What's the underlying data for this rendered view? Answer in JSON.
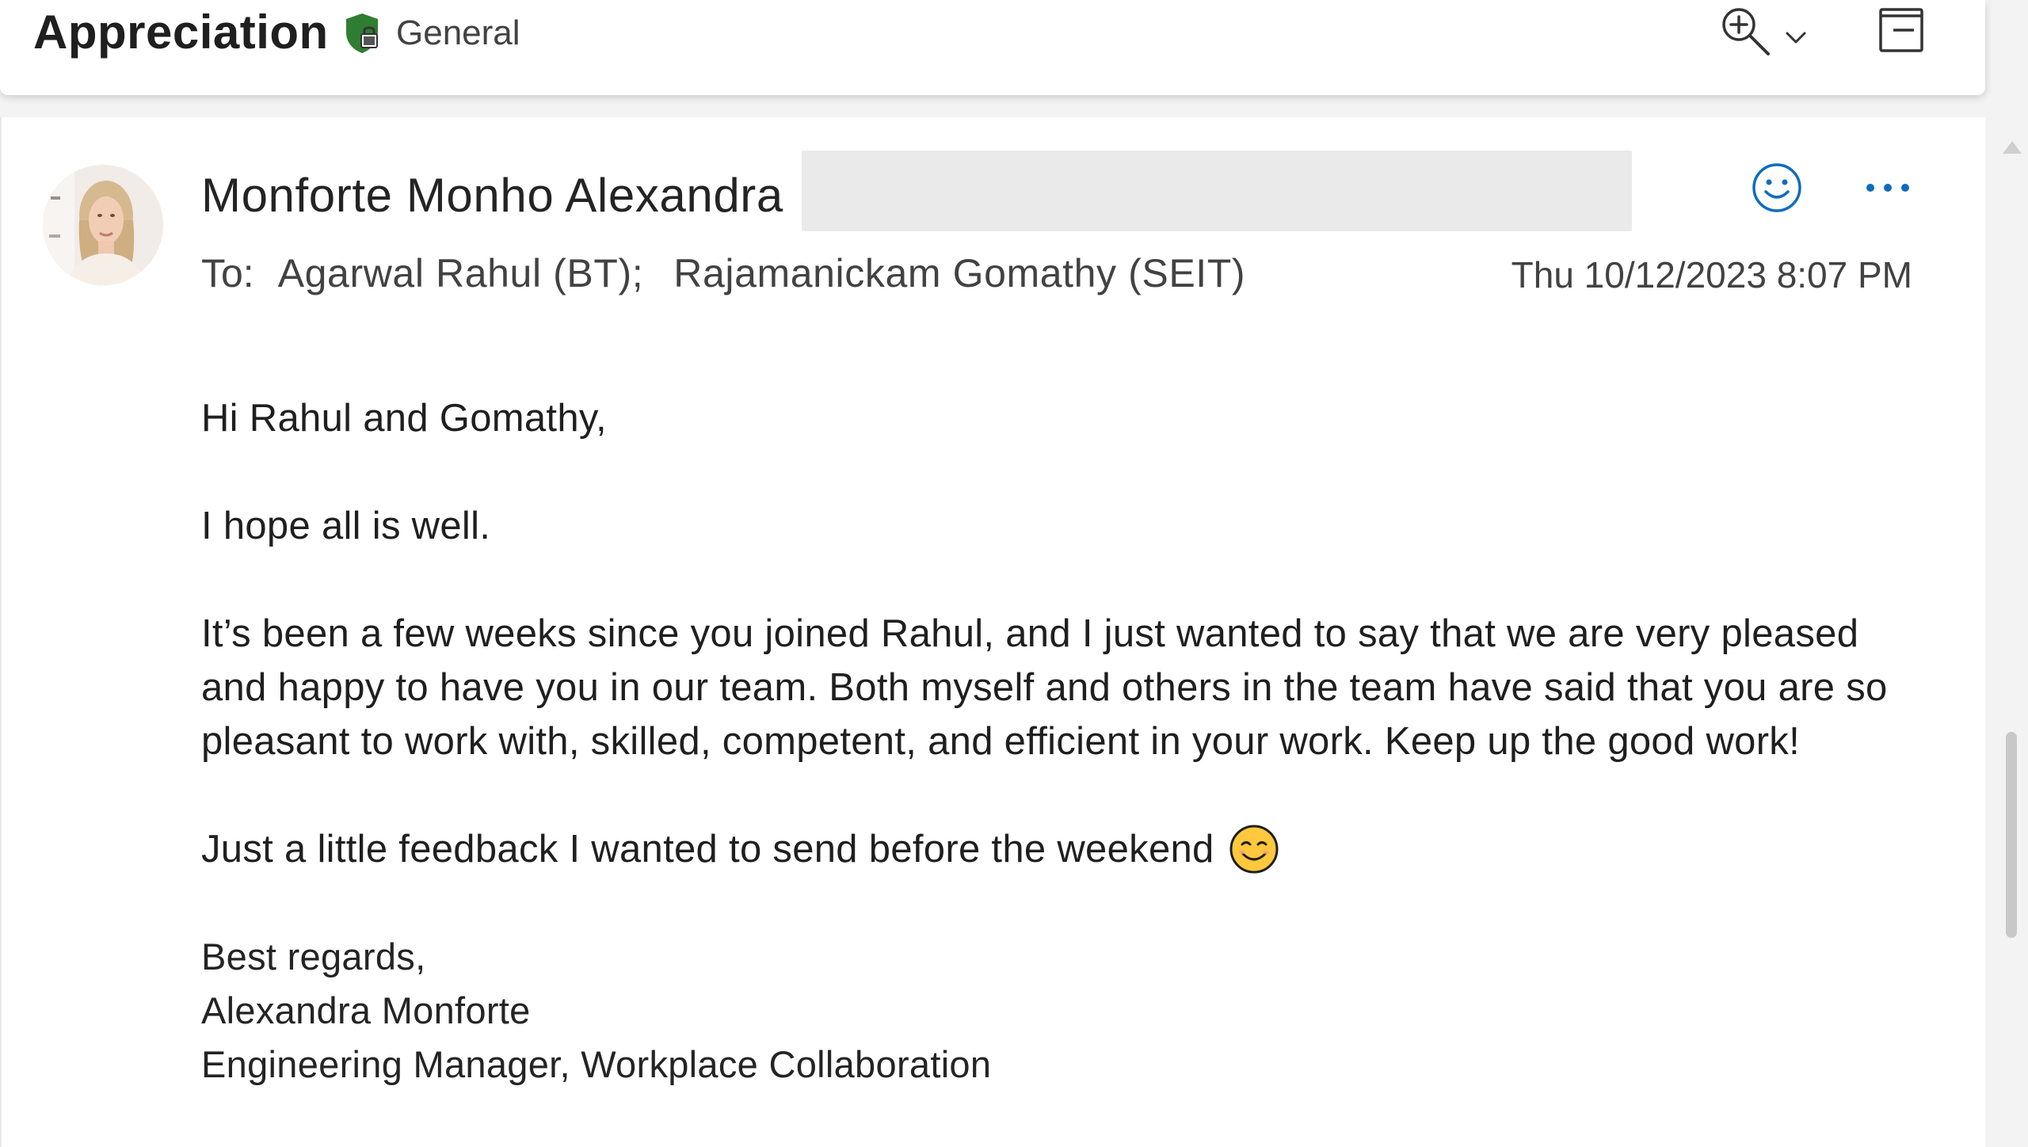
{
  "header": {
    "subject": "Appreciation",
    "sensitivity_label": "General",
    "icons": {
      "sensitivity": "shield-lock-icon",
      "zoom": "zoom-in-icon",
      "zoom_dropdown": "chevron-down-icon",
      "reading_pane": "reading-pane-icon"
    }
  },
  "message": {
    "sender_name": "Monforte Monho Alexandra",
    "to_label": "To:",
    "recipients": [
      "Agarwal Rahul (BT);",
      "Rajamanickam Gomathy (SEIT)"
    ],
    "sent_time": "Thu 10/12/2023 8:07 PM",
    "icons": {
      "react": "smiley-icon",
      "more": "more-options-icon",
      "avatar": "sender-avatar"
    },
    "body": {
      "greeting": "Hi Rahul and Gomathy,",
      "line1": "I hope all is well.",
      "paragraph": "It’s been a few weeks since you joined Rahul, and I just wanted to say that we are very pleased and happy to have you in our team. Both myself and others in the team have said that you are so pleasant to work with, skilled, competent, and efficient in your work. Keep up the good work!",
      "feedback": "Just a little feedback I wanted to send before the weekend",
      "feedback_emoji": "smiling-face-emoji"
    },
    "signature": {
      "closing": "Best regards,",
      "name": "Alexandra Monforte",
      "title": "Engineering Manager, Workplace Collaboration"
    }
  },
  "colors": {
    "accent_blue": "#0f6cbd",
    "sensitivity_green": "#2e7d32",
    "background": "#f3f3f3",
    "card": "#ffffff"
  }
}
